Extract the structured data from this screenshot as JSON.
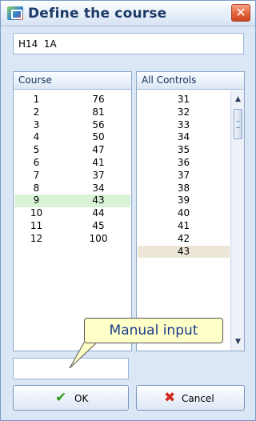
{
  "window": {
    "title": "Define the course",
    "close_glyph": "✕",
    "icon": "course-app-icon"
  },
  "course_name": {
    "value": "H14  1A"
  },
  "course_panel": {
    "header": "Course",
    "rows": [
      {
        "num": "1",
        "code": "76"
      },
      {
        "num": "2",
        "code": "81"
      },
      {
        "num": "3",
        "code": "56"
      },
      {
        "num": "4",
        "code": "50"
      },
      {
        "num": "5",
        "code": "47"
      },
      {
        "num": "6",
        "code": "41"
      },
      {
        "num": "7",
        "code": "37"
      },
      {
        "num": "8",
        "code": "34"
      },
      {
        "num": "9",
        "code": "43"
      },
      {
        "num": "10",
        "code": "44"
      },
      {
        "num": "11",
        "code": "45"
      },
      {
        "num": "12",
        "code": "100"
      }
    ],
    "selected_index": 8,
    "selected_color": "#d9f3d6"
  },
  "controls_panel": {
    "header": "All Controls",
    "items": [
      "31",
      "32",
      "33",
      "34",
      "35",
      "36",
      "37",
      "38",
      "39",
      "40",
      "41",
      "42",
      "43"
    ],
    "selected_index": 12,
    "selected_color": "#ece6d6",
    "scroll_up_glyph": "▲",
    "scroll_down_glyph": "▼"
  },
  "manual_input": {
    "value": "",
    "tooltip": "Manual input"
  },
  "buttons": {
    "ok": {
      "label": "OK",
      "icon": "checkmark-icon",
      "glyph": "✔",
      "color": "#2d9a1b"
    },
    "cancel": {
      "label": "Cancel",
      "icon": "cross-icon",
      "glyph": "✖",
      "color": "#d22b1b"
    }
  }
}
